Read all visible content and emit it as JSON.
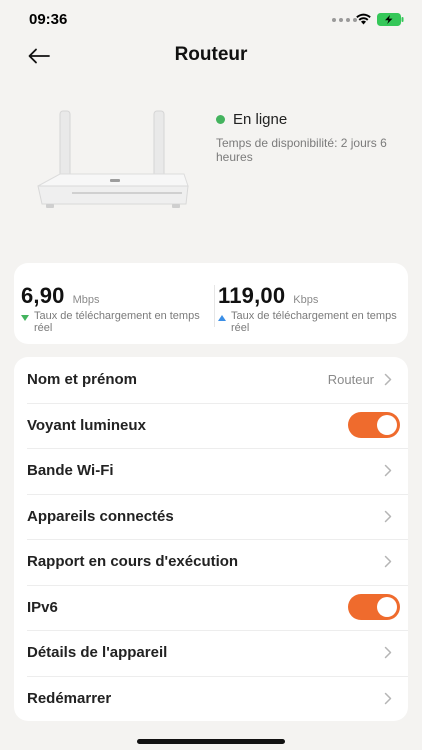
{
  "status_bar": {
    "time": "09:36",
    "icons": [
      "wifi-icon",
      "battery-charging-icon"
    ]
  },
  "header": {
    "title": "Routeur",
    "back_icon": "arrow-left-icon"
  },
  "device": {
    "image": "router-icon",
    "status": "En ligne",
    "status_color": "#43b35e",
    "uptime": "Temps de disponibilité: 2 jours 6 heures"
  },
  "speed": {
    "download": {
      "value": "6,90",
      "unit": "Mbps",
      "caption": "Taux de téléchargement en temps réel",
      "icon": "arrow-down-icon",
      "color": "#43b35e"
    },
    "upload": {
      "value": "119,00",
      "unit": "Kbps",
      "caption": "Taux de téléchargement en temps réel",
      "icon": "arrow-up-icon",
      "color": "#3a8ee6"
    }
  },
  "settings": {
    "accent_color": "#ef6b2d",
    "rows": [
      {
        "label": "Nom et prénom",
        "value": "Routeur",
        "type": "link"
      },
      {
        "label": "Voyant lumineux",
        "type": "toggle",
        "on": true
      },
      {
        "label": "Bande Wi-Fi",
        "type": "link"
      },
      {
        "label": "Appareils connectés",
        "type": "link"
      },
      {
        "label": "Rapport en cours d'exécution",
        "type": "link"
      },
      {
        "label": "IPv6",
        "type": "toggle",
        "on": true
      },
      {
        "label": "Détails de l'appareil",
        "type": "link"
      },
      {
        "label": "Redémarrer",
        "type": "link"
      }
    ]
  }
}
